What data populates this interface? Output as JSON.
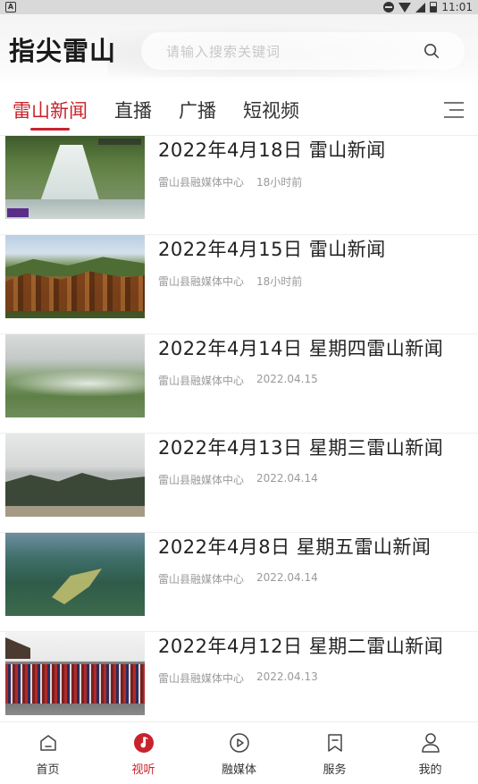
{
  "status_bar": {
    "time": "11:01"
  },
  "header": {
    "logo_text": "指尖雷山",
    "search_placeholder": "请输入搜索关键词"
  },
  "tabs": [
    {
      "label": "雷山新闻",
      "active": true
    },
    {
      "label": "直播",
      "active": false
    },
    {
      "label": "广播",
      "active": false
    },
    {
      "label": "短视频",
      "active": false
    }
  ],
  "news": [
    {
      "title": "2022年4月18日 雷山新闻",
      "source": "雷山县融媒体中心",
      "time": "18小时前"
    },
    {
      "title": "2022年4月15日 雷山新闻",
      "source": "雷山县融媒体中心",
      "time": "18小时前"
    },
    {
      "title": "2022年4月14日 星期四雷山新闻",
      "source": "雷山县融媒体中心",
      "time": "2022.04.15"
    },
    {
      "title": "2022年4月13日 星期三雷山新闻",
      "source": "雷山县融媒体中心",
      "time": "2022.04.14"
    },
    {
      "title": "2022年4月8日 星期五雷山新闻",
      "source": "雷山县融媒体中心",
      "time": "2022.04.14"
    },
    {
      "title": "2022年4月12日 星期二雷山新闻",
      "source": "雷山县融媒体中心",
      "time": "2022.04.13"
    }
  ],
  "bottom_nav": [
    {
      "label": "首页",
      "icon": "home-icon",
      "active": false
    },
    {
      "label": "视听",
      "icon": "music-icon",
      "active": true
    },
    {
      "label": "融媒体",
      "icon": "play-icon",
      "active": false
    },
    {
      "label": "服务",
      "icon": "bookmark-icon",
      "active": false
    },
    {
      "label": "我的",
      "icon": "user-icon",
      "active": false
    }
  ],
  "colors": {
    "accent": "#c8232c"
  }
}
